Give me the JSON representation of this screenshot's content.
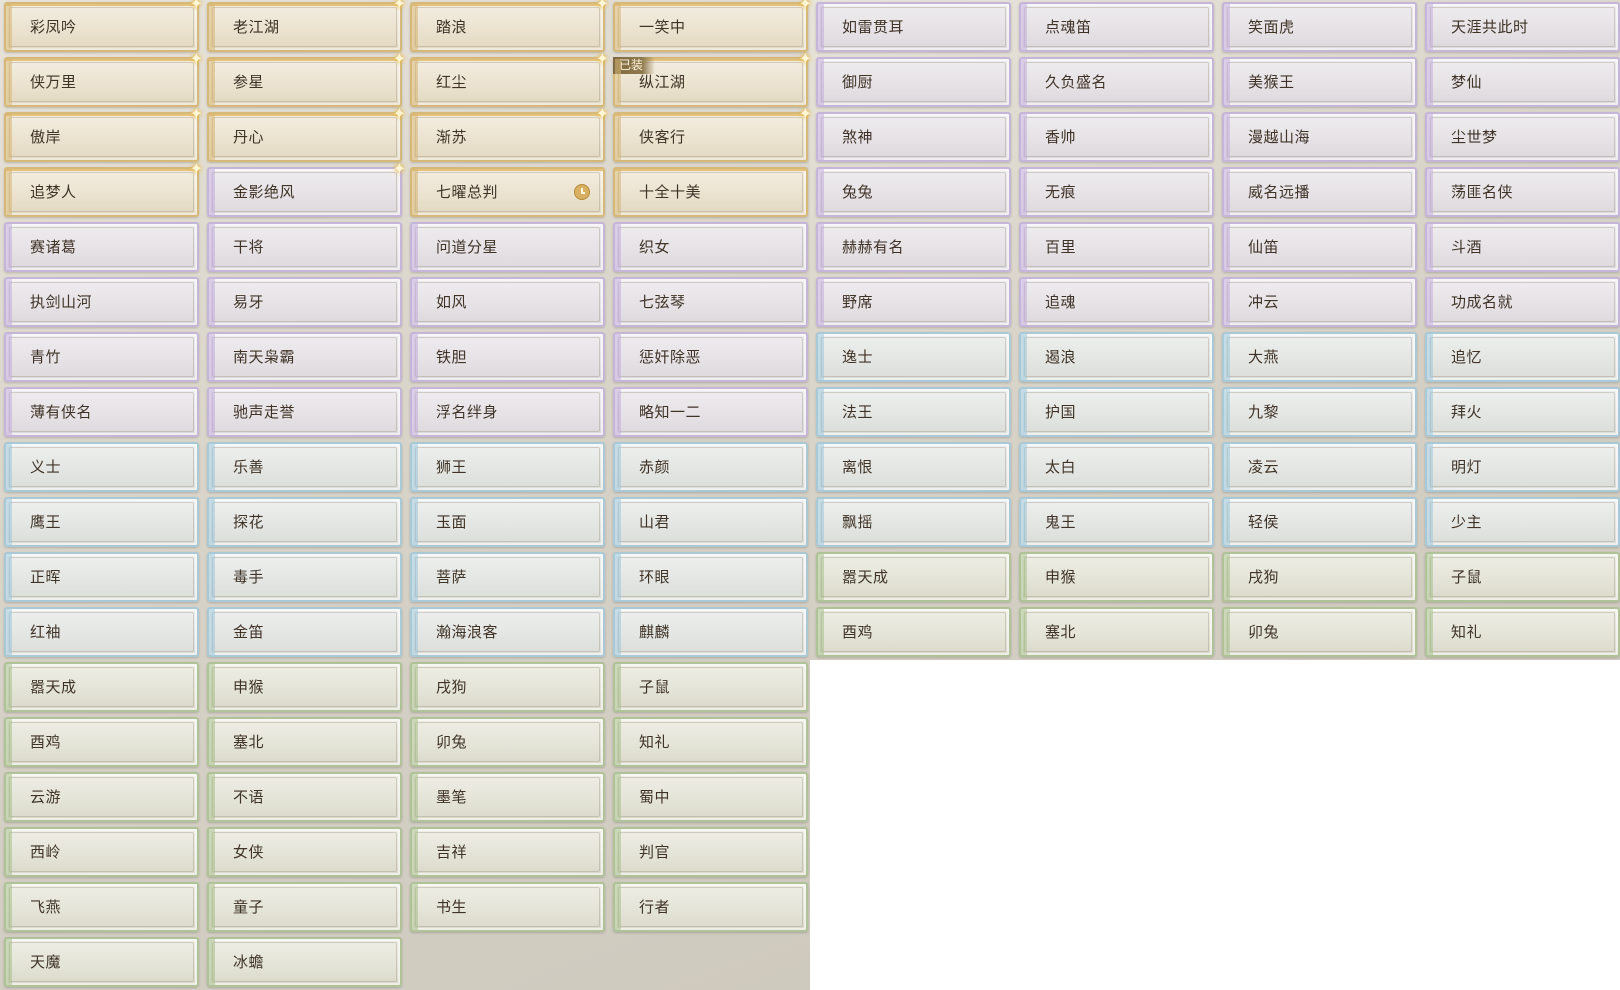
{
  "colors": {
    "gold": "#d7b773",
    "purple": "#c2addd",
    "blue": "#9dc6da",
    "green": "#a8bf8b",
    "text": "#3f3327"
  },
  "equipped_label": "已装",
  "titles": [
    {
      "label": "彩凤吟",
      "tier": "gold",
      "sparkle": true
    },
    {
      "label": "老江湖",
      "tier": "gold",
      "sparkle": true
    },
    {
      "label": "踏浪",
      "tier": "gold",
      "sparkle": true
    },
    {
      "label": "一笑中",
      "tier": "gold",
      "sparkle": true
    },
    {
      "label": "如雷贯耳",
      "tier": "purple"
    },
    {
      "label": "点魂笛",
      "tier": "purple"
    },
    {
      "label": "笑面虎",
      "tier": "purple"
    },
    {
      "label": "天涯共此时",
      "tier": "purple"
    },
    {
      "label": "侠万里",
      "tier": "gold",
      "sparkle": true
    },
    {
      "label": "参星",
      "tier": "gold",
      "sparkle": true
    },
    {
      "label": "红尘",
      "tier": "gold",
      "sparkle": true
    },
    {
      "label": "纵江湖",
      "tier": "gold",
      "sparkle": true,
      "equipped": true
    },
    {
      "label": "御厨",
      "tier": "purple"
    },
    {
      "label": "久负盛名",
      "tier": "purple"
    },
    {
      "label": "美猴王",
      "tier": "purple"
    },
    {
      "label": "梦仙",
      "tier": "purple"
    },
    {
      "label": "傲岸",
      "tier": "gold",
      "sparkle": true
    },
    {
      "label": "丹心",
      "tier": "gold",
      "sparkle": true
    },
    {
      "label": "渐苏",
      "tier": "gold",
      "sparkle": true
    },
    {
      "label": "侠客行",
      "tier": "gold",
      "sparkle": true
    },
    {
      "label": "煞神",
      "tier": "purple"
    },
    {
      "label": "香帅",
      "tier": "purple"
    },
    {
      "label": "漫越山海",
      "tier": "purple"
    },
    {
      "label": "尘世梦",
      "tier": "purple"
    },
    {
      "label": "追梦人",
      "tier": "gold",
      "sparkle": true
    },
    {
      "label": "金影绝风",
      "tier": "purple",
      "sparkle": true
    },
    {
      "label": "七曜总判",
      "tier": "gold",
      "timed": true
    },
    {
      "label": "十全十美",
      "tier": "gold"
    },
    {
      "label": "兔兔",
      "tier": "purple"
    },
    {
      "label": "无痕",
      "tier": "purple"
    },
    {
      "label": "威名远播",
      "tier": "purple"
    },
    {
      "label": "荡匪名侠",
      "tier": "purple"
    },
    {
      "label": "赛诸葛",
      "tier": "purple"
    },
    {
      "label": "干将",
      "tier": "purple"
    },
    {
      "label": "问道分星",
      "tier": "purple"
    },
    {
      "label": "织女",
      "tier": "purple"
    },
    {
      "label": "赫赫有名",
      "tier": "purple"
    },
    {
      "label": "百里",
      "tier": "purple"
    },
    {
      "label": "仙笛",
      "tier": "purple"
    },
    {
      "label": "斗酒",
      "tier": "purple"
    },
    {
      "label": "执剑山河",
      "tier": "purple"
    },
    {
      "label": "易牙",
      "tier": "purple"
    },
    {
      "label": "如风",
      "tier": "purple"
    },
    {
      "label": "七弦琴",
      "tier": "purple"
    },
    {
      "label": "野席",
      "tier": "purple"
    },
    {
      "label": "追魂",
      "tier": "purple"
    },
    {
      "label": "冲云",
      "tier": "purple"
    },
    {
      "label": "功成名就",
      "tier": "purple"
    },
    {
      "label": "青竹",
      "tier": "purple"
    },
    {
      "label": "南天枭霸",
      "tier": "purple"
    },
    {
      "label": "铁胆",
      "tier": "purple"
    },
    {
      "label": "惩奸除恶",
      "tier": "purple"
    },
    {
      "label": "逸士",
      "tier": "blue"
    },
    {
      "label": "遏浪",
      "tier": "blue"
    },
    {
      "label": "大燕",
      "tier": "blue"
    },
    {
      "label": "追忆",
      "tier": "blue"
    },
    {
      "label": "薄有侠名",
      "tier": "purple"
    },
    {
      "label": "驰声走誉",
      "tier": "purple"
    },
    {
      "label": "浮名绊身",
      "tier": "purple"
    },
    {
      "label": "略知一二",
      "tier": "purple"
    },
    {
      "label": "法王",
      "tier": "blue"
    },
    {
      "label": "护国",
      "tier": "blue"
    },
    {
      "label": "九黎",
      "tier": "blue"
    },
    {
      "label": "拜火",
      "tier": "blue"
    },
    {
      "label": "义士",
      "tier": "blue"
    },
    {
      "label": "乐善",
      "tier": "blue"
    },
    {
      "label": "狮王",
      "tier": "blue"
    },
    {
      "label": "赤颜",
      "tier": "blue"
    },
    {
      "label": "离恨",
      "tier": "blue"
    },
    {
      "label": "太白",
      "tier": "blue"
    },
    {
      "label": "凌云",
      "tier": "blue"
    },
    {
      "label": "明灯",
      "tier": "blue"
    },
    {
      "label": "鹰王",
      "tier": "blue"
    },
    {
      "label": "探花",
      "tier": "blue"
    },
    {
      "label": "玉面",
      "tier": "blue"
    },
    {
      "label": "山君",
      "tier": "blue"
    },
    {
      "label": "飘摇",
      "tier": "blue"
    },
    {
      "label": "鬼王",
      "tier": "blue"
    },
    {
      "label": "轻侯",
      "tier": "blue"
    },
    {
      "label": "少主",
      "tier": "blue"
    },
    {
      "label": "正晖",
      "tier": "blue"
    },
    {
      "label": "毒手",
      "tier": "blue"
    },
    {
      "label": "菩萨",
      "tier": "blue"
    },
    {
      "label": "环眼",
      "tier": "blue"
    },
    {
      "label": "嚣天成",
      "tier": "green"
    },
    {
      "label": "申猴",
      "tier": "green"
    },
    {
      "label": "戌狗",
      "tier": "green"
    },
    {
      "label": "子鼠",
      "tier": "green"
    },
    {
      "label": "红袖",
      "tier": "blue"
    },
    {
      "label": "金笛",
      "tier": "blue"
    },
    {
      "label": "瀚海浪客",
      "tier": "blue"
    },
    {
      "label": "麒麟",
      "tier": "blue"
    },
    {
      "label": "酉鸡",
      "tier": "green"
    },
    {
      "label": "塞北",
      "tier": "green"
    },
    {
      "label": "卯兔",
      "tier": "green"
    },
    {
      "label": "知礼",
      "tier": "green"
    },
    {
      "label": "嚣天成",
      "tier": "green"
    },
    {
      "label": "申猴",
      "tier": "green"
    },
    {
      "label": "戌狗",
      "tier": "green"
    },
    {
      "label": "子鼠",
      "tier": "green"
    },
    {
      "label": "酉鸡",
      "tier": "green"
    },
    {
      "label": "塞北",
      "tier": "green"
    },
    {
      "label": "卯兔",
      "tier": "green"
    },
    {
      "label": "知礼",
      "tier": "green"
    },
    {
      "label": "云游",
      "tier": "green"
    },
    {
      "label": "不语",
      "tier": "green"
    },
    {
      "label": "墨笔",
      "tier": "green"
    },
    {
      "label": "蜀中",
      "tier": "green"
    },
    {
      "label": "西岭",
      "tier": "green"
    },
    {
      "label": "女侠",
      "tier": "green"
    },
    {
      "label": "吉祥",
      "tier": "green"
    },
    {
      "label": "判官",
      "tier": "green"
    },
    {
      "label": "飞燕",
      "tier": "green"
    },
    {
      "label": "童子",
      "tier": "green"
    },
    {
      "label": "书生",
      "tier": "green"
    },
    {
      "label": "行者",
      "tier": "green"
    },
    {
      "label": "天魔",
      "tier": "green"
    },
    {
      "label": "冰蟾",
      "tier": "green"
    }
  ]
}
